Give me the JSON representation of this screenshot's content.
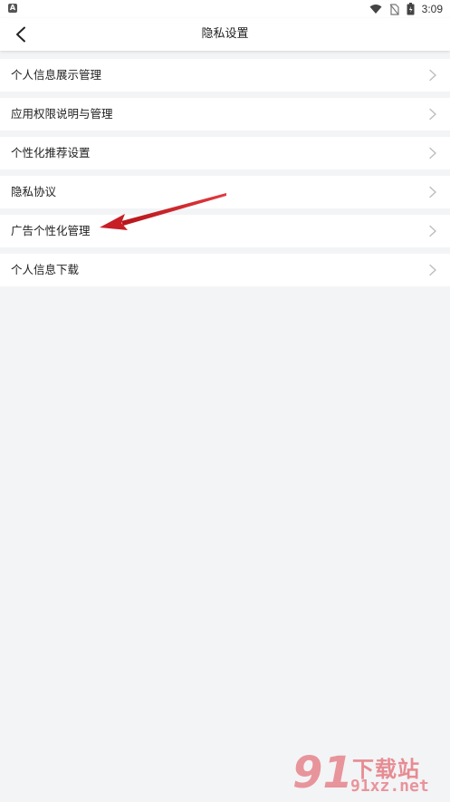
{
  "status_bar": {
    "app_badge": "A",
    "time": "3:09",
    "icons": [
      "wifi-icon",
      "no-sim-icon",
      "battery-icon"
    ]
  },
  "header": {
    "title": "隐私设置",
    "back_icon": "chevron-left-icon"
  },
  "menu": {
    "items": [
      {
        "label": "个人信息展示管理",
        "icon": "chevron-right-icon"
      },
      {
        "label": "应用权限说明与管理",
        "icon": "chevron-right-icon"
      },
      {
        "label": "个性化推荐设置",
        "icon": "chevron-right-icon"
      },
      {
        "label": "隐私协议",
        "icon": "chevron-right-icon"
      },
      {
        "label": "广告个性化管理",
        "icon": "chevron-right-icon"
      },
      {
        "label": "个人信息下载",
        "icon": "chevron-right-icon"
      }
    ]
  },
  "annotation": {
    "type": "arrow",
    "color": "#d9262c",
    "points_to": "广告个性化管理"
  },
  "watermark": {
    "number": "91",
    "text": "下载站",
    "url": "91xz.net",
    "color": "#de4650"
  },
  "colors": {
    "page_background": "#f3f4f6",
    "item_background": "#ffffff",
    "chevron": "#bbbbbb"
  }
}
